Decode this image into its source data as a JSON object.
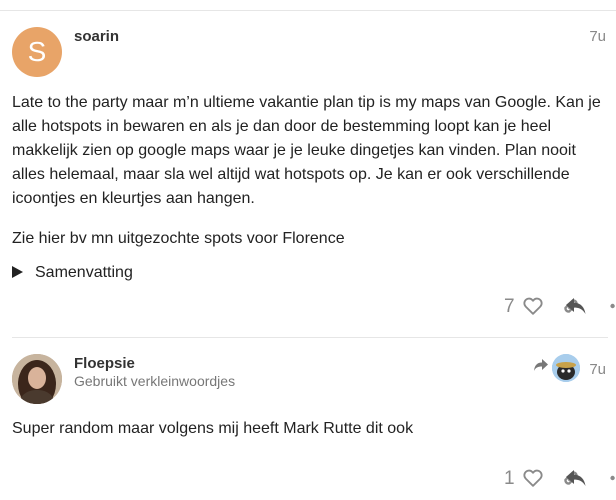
{
  "post1": {
    "avatar_letter": "S",
    "username": "soarin",
    "date": "7u",
    "paragraphs": [
      "Late to the party maar m’n ultieme vakantie plan tip is my maps van Google. Kan je alle hotspots in bewaren en als je dan door de bestemming loopt kan je heel makkelijk zien op google maps waar je je leuke dingetjes kan vinden. Plan nooit alles helemaal, maar sla wel altijd wat hotspots op. Je kan er ook verschillende icoontjes en kleurtjes aan hangen.",
      "Zie hier bv mn uitgezochte spots voor Florence"
    ],
    "details_summary": "Samenvatting",
    "like_count": "7"
  },
  "post2": {
    "username": "Floepsie",
    "user_title": "Gebruikt verkleinwoordjes",
    "date": "7u",
    "text": "Super random maar volgens mij heeft Mark Rutte dit ook",
    "like_count": "1"
  },
  "icons": {
    "like": "heart-icon",
    "share": "link-icon",
    "more": "ellipsis-icon",
    "reply": "reply-icon",
    "reply_to": "reply-arrow-icon"
  },
  "colors": {
    "avatar_orange": "#e8a468",
    "muted": "#8a8a8a"
  }
}
